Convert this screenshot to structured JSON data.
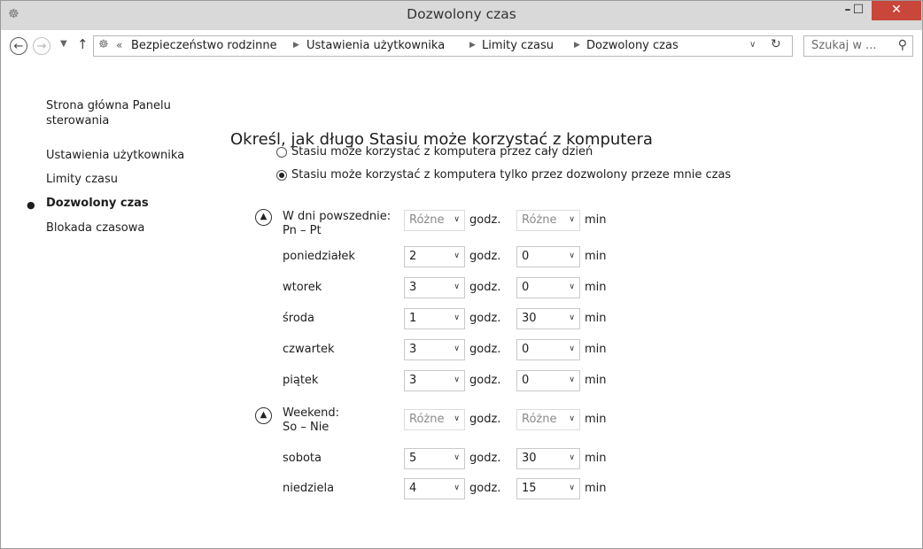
{
  "window": {
    "title": "Dozwolony czas"
  },
  "address": {
    "crumbs": [
      "Bezpieczeństwo rodzinne",
      "Ustawienia użytkownika",
      "Limity czasu",
      "Dozwolony czas"
    ],
    "search_placeholder": "Szukaj w ..."
  },
  "sidebar": {
    "home_line1": "Strona główna Panelu",
    "home_line2": "sterowania",
    "items": [
      "Ustawienia użytkownika",
      "Limity czasu",
      "Dozwolony czas",
      "Blokada czasowa"
    ],
    "current_index": 2
  },
  "main": {
    "heading": "Określ, jak długo Stasiu może korzystać z komputera",
    "options": [
      {
        "label": "Stasiu może korzystać z komputera przez cały dzień",
        "checked": false
      },
      {
        "label": "Stasiu może korzystać z komputera tylko przez dozwolony przeze mnie czas",
        "checked": true
      }
    ],
    "units": {
      "hours": "godz.",
      "minutes": "min"
    },
    "weekdays": {
      "label_line1": "W dni powszednie:",
      "label_line2": "Pn – Pt",
      "hours": "Różne",
      "minutes": "Różne",
      "days": [
        {
          "name": "poniedziałek",
          "hours": "2",
          "minutes": "0"
        },
        {
          "name": "wtorek",
          "hours": "3",
          "minutes": "0"
        },
        {
          "name": "środa",
          "hours": "1",
          "minutes": "30"
        },
        {
          "name": "czwartek",
          "hours": "3",
          "minutes": "0"
        },
        {
          "name": "piątek",
          "hours": "3",
          "minutes": "0"
        }
      ]
    },
    "weekend": {
      "label_line1": "Weekend:",
      "label_line2": "So – Nie",
      "hours": "Różne",
      "minutes": "Różne",
      "days": [
        {
          "name": "sobota",
          "hours": "5",
          "minutes": "30"
        },
        {
          "name": "niedziela",
          "hours": "4",
          "minutes": "15"
        }
      ]
    }
  }
}
